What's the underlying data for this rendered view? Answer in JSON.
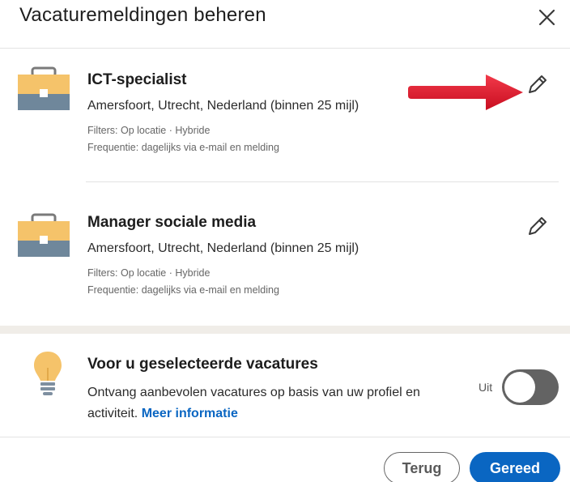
{
  "dialog": {
    "title": "Vacaturemeldingen beheren",
    "close_icon": "close-icon"
  },
  "alerts": [
    {
      "icon": "briefcase-icon",
      "title": "ICT-specialist",
      "location": "Amersfoort, Utrecht, Nederland (binnen 25 mijl)",
      "filters": "Filters: Op locatie · Hybride",
      "frequency": "Frequentie: dagelijks via e-mail en melding",
      "edit_icon": "pencil-icon"
    },
    {
      "icon": "briefcase-icon",
      "title": "Manager sociale media",
      "location": "Amersfoort, Utrecht, Nederland (binnen 25 mijl)",
      "filters": "Filters: Op locatie · Hybride",
      "frequency": "Frequentie: dagelijks via e-mail en melding",
      "edit_icon": "pencil-icon"
    }
  ],
  "recommended": {
    "icon": "lightbulb-icon",
    "title": "Voor u geselecteerde vacatures",
    "description": "Ontvang aanbevolen vacatures op basis van uw profiel en activiteit.",
    "more_link": "Meer informatie",
    "toggle_label": "Uit",
    "toggle_on": false
  },
  "footer": {
    "back_label": "Terug",
    "done_label": "Gereed"
  },
  "annotation": {
    "arrow_color": "#e0162b"
  },
  "colors": {
    "accent": "#0a66c2",
    "briefcase_top": "#f5c36a",
    "briefcase_bottom": "#6f879b",
    "bulb": "#f5c36a"
  }
}
